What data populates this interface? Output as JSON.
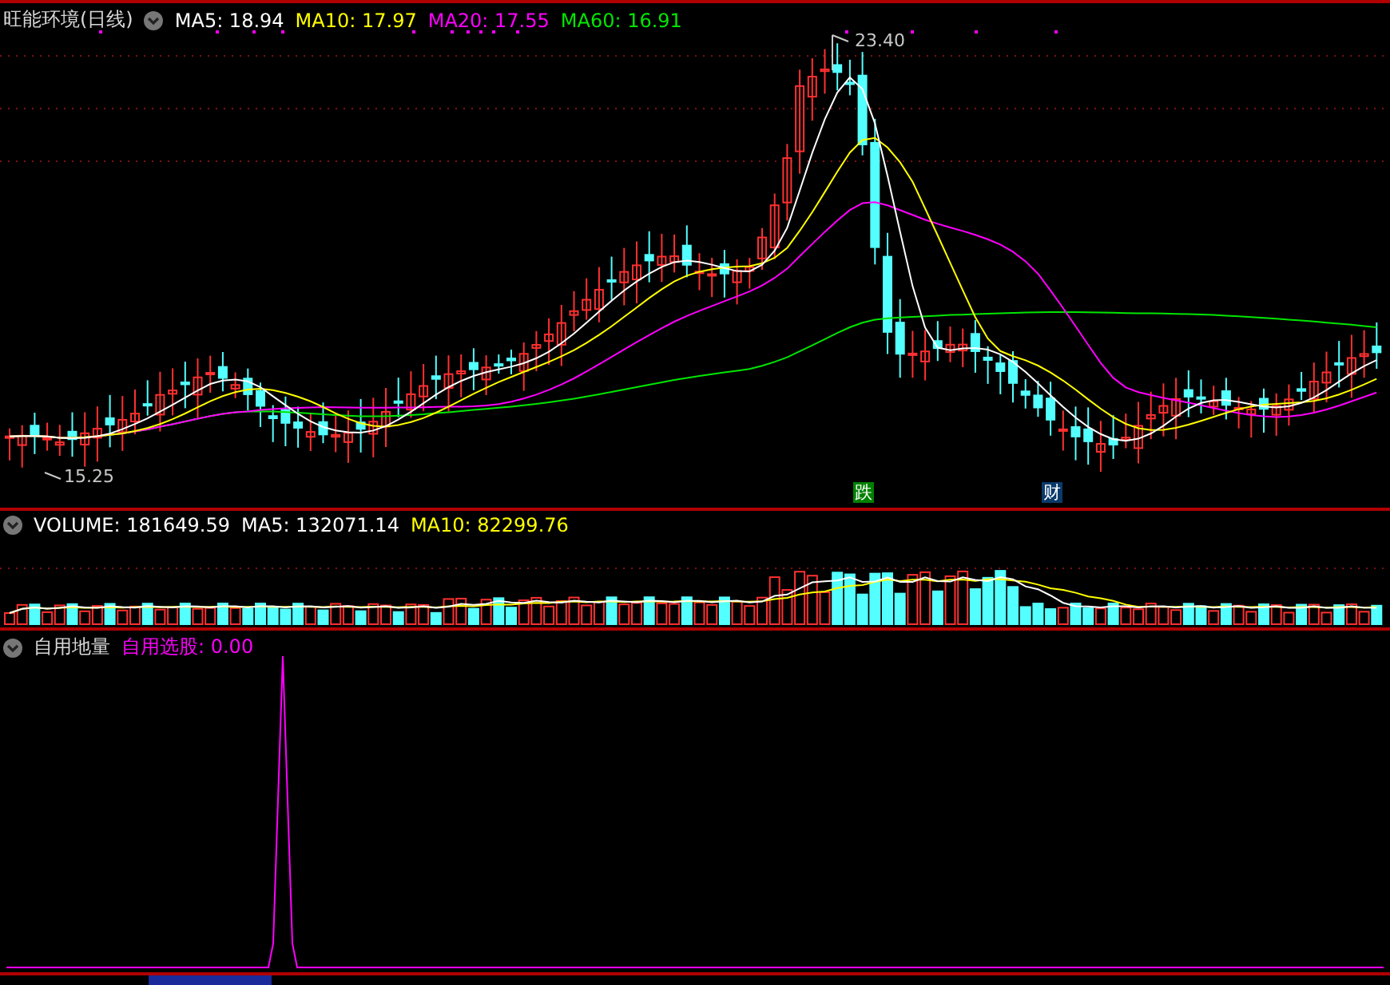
{
  "price_pane": {
    "title": "旺能环境(日线)",
    "indicators": [
      {
        "text": "MA5: 18.94",
        "color": "#ffffff"
      },
      {
        "text": "MA10: 17.97",
        "color": "#ffff00"
      },
      {
        "text": "MA20: 17.55",
        "color": "#ff00ff"
      },
      {
        "text": "MA60: 16.91",
        "color": "#00e600"
      }
    ],
    "high_label": "23.40",
    "low_label": "15.25",
    "markers": [
      {
        "text": "跌",
        "color": "#008000"
      },
      {
        "text": "财",
        "color": "#0a3a6a"
      }
    ]
  },
  "volume_pane": {
    "indicators": [
      {
        "text": "VOLUME: 181649.59",
        "color": "#ffffff"
      },
      {
        "text": "MA5: 132071.14",
        "color": "#ffffff"
      },
      {
        "text": "MA10: 82299.76",
        "color": "#ffff00"
      }
    ]
  },
  "signal_pane": {
    "title": "自用地量",
    "indicators": [
      {
        "text": "自用选股: 0.00",
        "color": "#ff00ff"
      }
    ]
  }
}
